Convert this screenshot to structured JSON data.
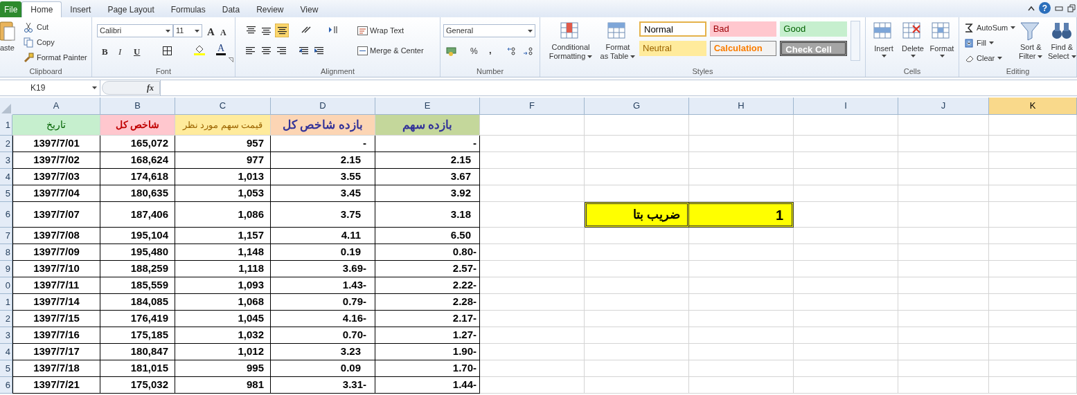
{
  "ribbon_tabs": [
    {
      "label": "File",
      "kind": "file",
      "selected": false
    },
    {
      "label": "Home",
      "kind": "tab",
      "selected": true
    },
    {
      "label": "Insert",
      "kind": "tab",
      "selected": false
    },
    {
      "label": "Page Layout",
      "kind": "tab",
      "selected": false
    },
    {
      "label": "Formulas",
      "kind": "tab",
      "selected": false
    },
    {
      "label": "Data",
      "kind": "tab",
      "selected": false
    },
    {
      "label": "Review",
      "kind": "tab",
      "selected": false
    },
    {
      "label": "View",
      "kind": "tab",
      "selected": false
    }
  ],
  "help": "?",
  "clipboard": {
    "label": "Clipboard",
    "paste": "aste",
    "cut": "Cut",
    "copy": "Copy",
    "format_painter": "Format Painter"
  },
  "font": {
    "label": "Font",
    "name": "Calibri",
    "size": "11",
    "grow": "A",
    "shrink": "A",
    "bold": "B",
    "italic": "I",
    "underline": "U",
    "font_color": "A"
  },
  "alignment": {
    "label": "Alignment",
    "wrap_text": "Wrap Text",
    "merge_center": "Merge & Center"
  },
  "number": {
    "label": "Number",
    "format": "General",
    "percent": "%",
    "comma": ","
  },
  "styles": {
    "label": "Styles",
    "conditional": [
      "Conditional",
      "Formatting"
    ],
    "format_table": [
      "Format",
      "as Table"
    ],
    "gallery": [
      {
        "label": "Normal",
        "kind": "normal"
      },
      {
        "label": "Bad",
        "kind": "bad"
      },
      {
        "label": "Good",
        "kind": "good"
      },
      {
        "label": "Neutral",
        "kind": "neutral"
      },
      {
        "label": "Calculation",
        "kind": "calculation"
      },
      {
        "label": "Check Cell",
        "kind": "check"
      }
    ]
  },
  "cells": {
    "label": "Cells",
    "buttons": [
      "Insert",
      "Delete",
      "Format"
    ]
  },
  "editing": {
    "label": "Editing",
    "autosum": "AutoSum",
    "fill": "Fill",
    "clear": "Clear",
    "sort": [
      "Sort &",
      "Filter"
    ],
    "find": [
      "Find &",
      "Select"
    ]
  },
  "name_box": "K19",
  "fx": "fx",
  "columns": [
    {
      "label": "A",
      "selected": false,
      "heading": {
        "text": "تاریخ",
        "kind": "good"
      }
    },
    {
      "label": "B",
      "selected": false,
      "heading": {
        "text": "شاخص کل",
        "kind": "bad"
      }
    },
    {
      "label": "C",
      "selected": false,
      "heading": {
        "text": "قیمت سهم مورد نظر",
        "kind": "neutral"
      }
    },
    {
      "label": "D",
      "selected": false,
      "heading": {
        "text": "بازده شاخص کل",
        "kind": "orange"
      }
    },
    {
      "label": "E",
      "selected": false,
      "heading": {
        "text": "بازده سهم",
        "kind": "olive"
      }
    },
    {
      "label": "F",
      "selected": false
    },
    {
      "label": "G",
      "selected": false
    },
    {
      "label": "H",
      "selected": false
    },
    {
      "label": "I",
      "selected": false
    },
    {
      "label": "J",
      "selected": false
    },
    {
      "label": "K",
      "selected": true
    }
  ],
  "header_row_number": "1",
  "rows": [
    {
      "number": "2",
      "cells": [
        "1397/7/01",
        "165,072",
        "957",
        "-",
        "-"
      ]
    },
    {
      "number": "3",
      "cells": [
        "1397/7/02",
        "168,624",
        "977",
        "2.15",
        "2.15"
      ]
    },
    {
      "number": "4",
      "cells": [
        "1397/7/03",
        "174,618",
        "1,013",
        "3.55",
        "3.67"
      ]
    },
    {
      "number": "5",
      "cells": [
        "1397/7/04",
        "180,635",
        "1,053",
        "3.45",
        "3.92"
      ]
    },
    {
      "number": "6",
      "cells": [
        "1397/7/07",
        "187,406",
        "1,086",
        "3.75",
        "3.18"
      ]
    },
    {
      "number": "7",
      "cells": [
        "1397/7/08",
        "195,104",
        "1,157",
        "4.11",
        "6.50"
      ]
    },
    {
      "number": "8",
      "cells": [
        "1397/7/09",
        "195,480",
        "1,148",
        "0.19",
        "0.80-"
      ]
    },
    {
      "number": "9",
      "cells": [
        "1397/7/10",
        "188,259",
        "1,118",
        "3.69-",
        "2.57-"
      ]
    },
    {
      "number": "0",
      "cells": [
        "1397/7/11",
        "185,559",
        "1,093",
        "1.43-",
        "2.22-"
      ]
    },
    {
      "number": "1",
      "cells": [
        "1397/7/14",
        "184,085",
        "1,068",
        "0.79-",
        "2.28-"
      ]
    },
    {
      "number": "2",
      "cells": [
        "1397/7/15",
        "176,419",
        "1,045",
        "4.16-",
        "2.17-"
      ]
    },
    {
      "number": "3",
      "cells": [
        "1397/7/16",
        "175,185",
        "1,032",
        "0.70-",
        "1.27-"
      ]
    },
    {
      "number": "4",
      "cells": [
        "1397/7/17",
        "180,847",
        "1,012",
        "3.23",
        "1.90-"
      ]
    },
    {
      "number": "5",
      "cells": [
        "1397/7/18",
        "181,015",
        "995",
        "0.09",
        "1.70-"
      ]
    },
    {
      "number": "6",
      "cells": [
        "1397/7/21",
        "175,032",
        "981",
        "3.31-",
        "1.44-"
      ]
    }
  ],
  "beta_box": {
    "label": "ضریب بتا",
    "value": "1"
  }
}
